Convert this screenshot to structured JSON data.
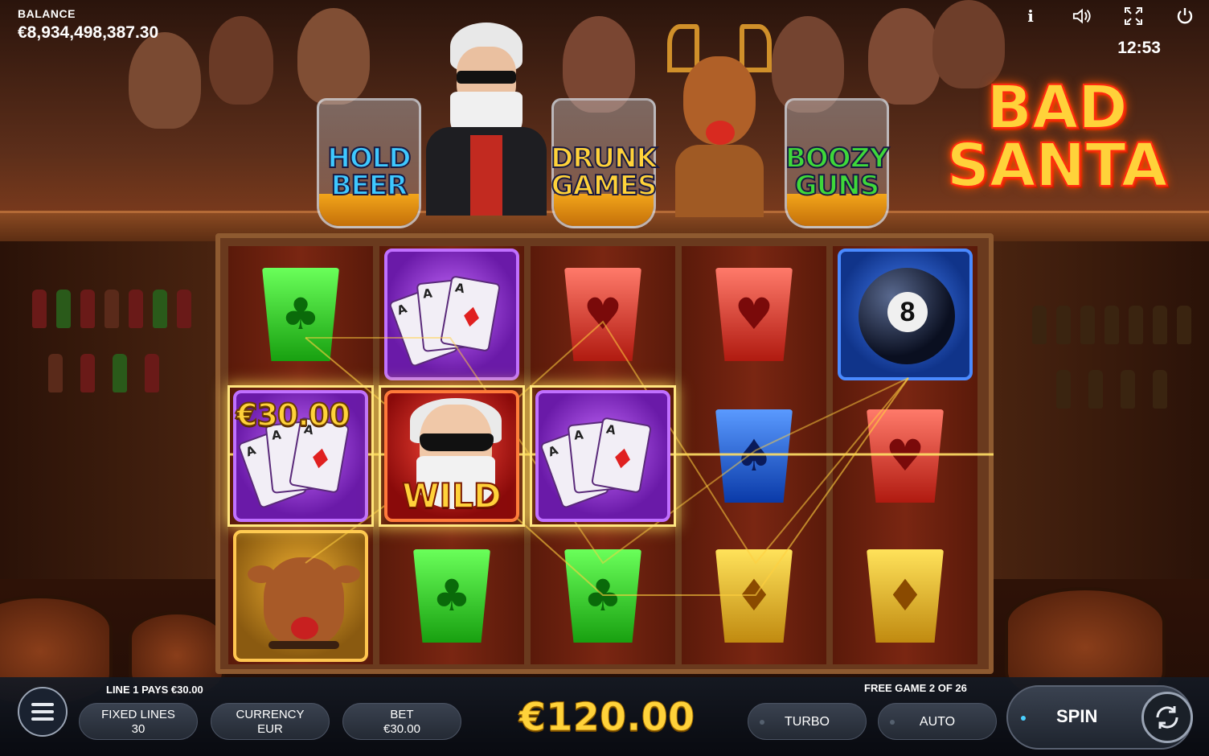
{
  "hud": {
    "balance_label": "BALANCE",
    "balance_value": "€8,934,498,387.30",
    "clock": "12:53",
    "icons": [
      "info-icon",
      "sound-icon",
      "fullscreen-icon",
      "power-icon"
    ],
    "info_glyph": "i"
  },
  "features": [
    {
      "line1": "HOLD",
      "line2": "BEER",
      "color": "#3ec8ff"
    },
    {
      "line1": "DRUNK",
      "line2": "GAMES",
      "color": "#ffd23a"
    },
    {
      "line1": "BOOZY",
      "line2": "GUNS",
      "color": "#3ed83a"
    }
  ],
  "logo": {
    "line1": "BAD",
    "line2": "SANTA"
  },
  "reels": [
    [
      "green-club-shot",
      "purple-aces",
      "reindeer"
    ],
    [
      "purple-aces",
      "wild-santa",
      "green-club-shot"
    ],
    [
      "red-heart-shot",
      "purple-aces",
      "green-club-shot"
    ],
    [
      "red-heart-shot",
      "blue-spade-shot",
      "yellow-diamond-shot"
    ],
    [
      "blue-eight-ball",
      "red-heart-shot",
      "yellow-diamond-shot"
    ]
  ],
  "symbols": {
    "card_letter": "A",
    "wild_label": "WILD",
    "eight_ball_number": "8",
    "suits": {
      "club": "♣",
      "heart": "♥",
      "spade": "♠",
      "diamond": "♦"
    }
  },
  "win_on_symbol": "€30.00",
  "bottom": {
    "line_pays": "LINE 1 PAYS €30.00",
    "free_game": "FREE GAME 2 OF 26",
    "fixed_lines_label": "FIXED LINES",
    "fixed_lines_value": "30",
    "currency_label": "CURRENCY",
    "currency_value": "EUR",
    "bet_label": "BET",
    "bet_value": "€30.00",
    "total_win": "€120.00",
    "turbo_label": "TURBO",
    "auto_label": "AUTO",
    "spin_label": "SPIN"
  },
  "colors": {
    "accent_gold": "#ffd23a",
    "win_highlight": "#ffe680",
    "shot_green": "#2ed81a",
    "shot_red": "#e03a2a",
    "shot_blue": "#1e6aff",
    "shot_yellow": "#f2c020"
  }
}
